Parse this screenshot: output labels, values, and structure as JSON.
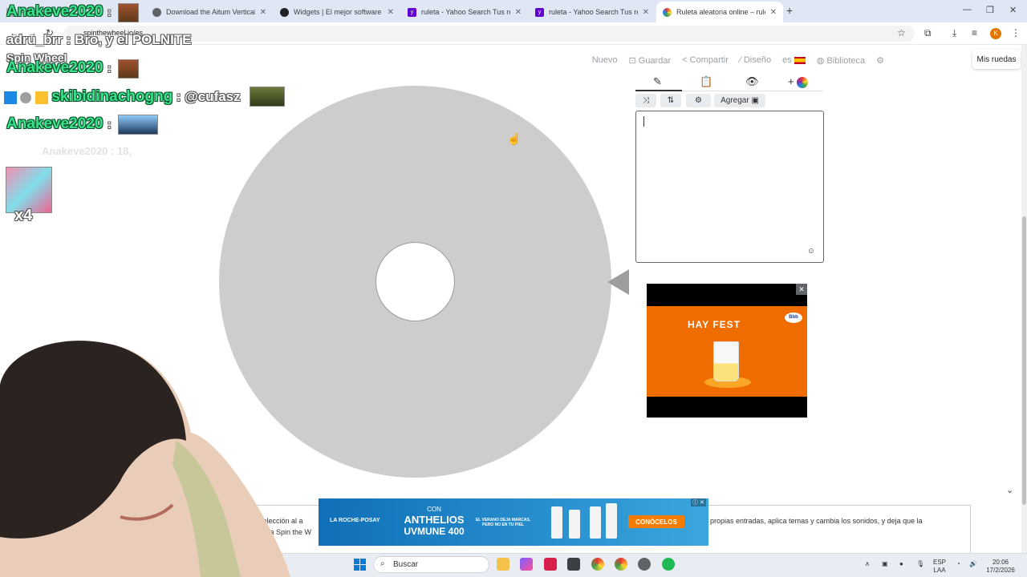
{
  "tabs": [
    {
      "title": "Anakeve2020",
      "color": "#5f6368"
    },
    {
      "title": "Download the Aitum Vertical Pl",
      "color": "#5f6368"
    },
    {
      "title": "Widgets | El mejor software par",
      "color": "#202124"
    },
    {
      "title": "ruleta - Yahoo Search Tus result",
      "color": "#6001d2"
    },
    {
      "title": "ruleta - Yahoo Search Tus result",
      "color": "#6001d2"
    },
    {
      "title": "Ruleta aleatoria online – ruleta",
      "color": "#e53935"
    }
  ],
  "new_tab": "+",
  "address": "spinthewheel.io/es",
  "profile_initial": "K",
  "site": {
    "logo": "Spin Wheel",
    "nav": {
      "nuevo": "Nuevo",
      "guardar": "Guardar",
      "compartir": "Compartir",
      "diseno": "Diseño",
      "lang": "es",
      "biblioteca": "Biblioteca"
    },
    "mis_ruedas": "Mis ruedas"
  },
  "panel": {
    "add_label": "Agregar"
  },
  "ad": {
    "headline": "HAY FEST",
    "logo": "Bbb"
  },
  "description": {
    "line1": "ra de selección al a",
    "line2": "llama Spin the W",
    "right": "propias entradas, aplica temas y cambia los sonidos, y deja que la"
  },
  "banner": {
    "brand": "LA ROCHE-POSAY",
    "con": "CON",
    "anthelios": "ANTHELIOS",
    "uvmune": "UVMUNE 400",
    "tagline": "EL VERANO DEJA MARCAS, PERO NO EN TU PIEL",
    "cta": "CONÓCELOS"
  },
  "taskbar": {
    "search_placeholder": "Buscar",
    "lang_top": "ESP",
    "lang_bottom": "LAA",
    "time": "20:06",
    "date": "17/2/2026"
  },
  "overlay": {
    "chat1_user": "adru_brr",
    "chat1_msg": ": Bro, y el POLNITE",
    "chat2_user": "Anakeve2020",
    "chat3_user": "skibidinachogng",
    "chat3_msg": ": @cufasz",
    "chat4_user": "Anakeve2020",
    "faint": "Anakeve2020 : 18,",
    "x4": "x4",
    "colon": ":"
  }
}
